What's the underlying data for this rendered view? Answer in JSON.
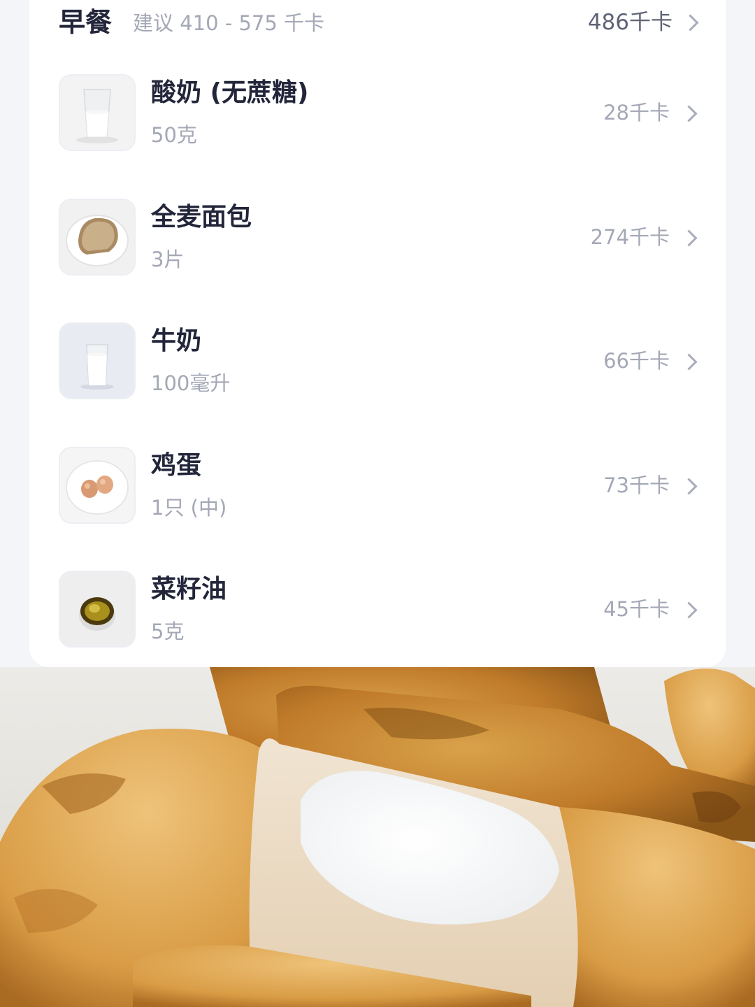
{
  "meal": {
    "title": "早餐",
    "suggestion": "建议 410 - 575 千卡",
    "total": "486千卡"
  },
  "items": [
    {
      "name": "酸奶 (无蔗糖)",
      "quantity": "50克",
      "kcal": "28千卡",
      "icon": "yogurt-glass-icon"
    },
    {
      "name": "全麦面包",
      "quantity": "3片",
      "kcal": "274千卡",
      "icon": "bread-plate-icon"
    },
    {
      "name": "牛奶",
      "quantity": "100毫升",
      "kcal": "66千卡",
      "icon": "milk-glass-icon"
    },
    {
      "name": "鸡蛋",
      "quantity": "1只 (中)",
      "kcal": "73千卡",
      "icon": "eggs-plate-icon"
    },
    {
      "name": "菜籽油",
      "quantity": "5克",
      "kcal": "45千卡",
      "icon": "oil-dish-icon"
    }
  ],
  "colors": {
    "background": "#f4f5f9",
    "card": "#ffffff",
    "title_text": "#23263a",
    "muted_text": "#a4a8b6"
  }
}
